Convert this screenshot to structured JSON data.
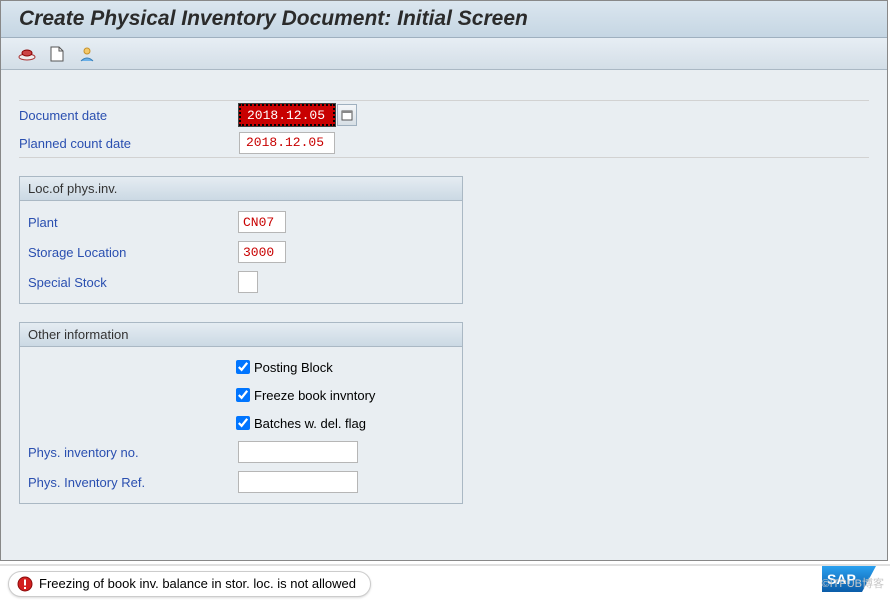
{
  "title": "Create Physical Inventory Document: Initial Screen",
  "dates": {
    "doc_label": "Document date",
    "doc_value": "2018.12.05",
    "planned_label": "Planned count date",
    "planned_value": "2018.12.05"
  },
  "loc_group": {
    "title": "Loc.of phys.inv.",
    "plant_label": "Plant",
    "plant_value": "CN07",
    "sloc_label": "Storage Location",
    "sloc_value": "3000",
    "special_label": "Special Stock",
    "special_value": ""
  },
  "other_group": {
    "title": "Other information",
    "posting_block": "Posting Block",
    "freeze": "Freeze book invntory",
    "batches": "Batches w. del. flag",
    "pino_label": "Phys. inventory no.",
    "pino_value": "",
    "piref_label": "Phys. Inventory Ref.",
    "piref_value": ""
  },
  "status": {
    "message": "Freezing of book inv. balance in stor. loc. is not allowed"
  },
  "watermark": "©ITPUB博客"
}
